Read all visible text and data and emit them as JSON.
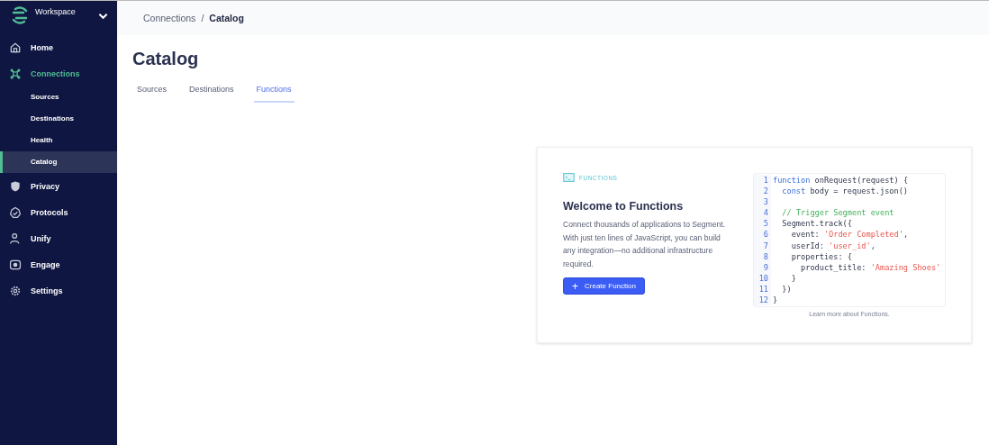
{
  "sidebar": {
    "workspace": "Workspace",
    "items": [
      {
        "label": "Home",
        "kind": "main",
        "selected": false
      },
      {
        "label": "Connections",
        "kind": "main",
        "selected": true
      },
      {
        "label": "Sources",
        "kind": "sub",
        "selected": false
      },
      {
        "label": "Destinations",
        "kind": "sub",
        "selected": false
      },
      {
        "label": "Health",
        "kind": "sub",
        "selected": false
      },
      {
        "label": "Catalog",
        "kind": "sub",
        "selected": true
      },
      {
        "label": "Privacy",
        "kind": "main",
        "selected": false
      },
      {
        "label": "Protocols",
        "kind": "main",
        "selected": false
      },
      {
        "label": "Unify",
        "kind": "main",
        "selected": false
      },
      {
        "label": "Engage",
        "kind": "main",
        "selected": false
      },
      {
        "label": "Settings",
        "kind": "main",
        "selected": false
      }
    ]
  },
  "breadcrumb": {
    "parent": "Connections",
    "separator": "/",
    "current": "Catalog"
  },
  "page_title": "Catalog",
  "tabs": [
    {
      "label": "Sources",
      "selected": false
    },
    {
      "label": "Destinations",
      "selected": false
    },
    {
      "label": "Functions",
      "selected": true
    }
  ],
  "card": {
    "eyebrow": "FUNCTIONS",
    "heading": "Welcome to Functions",
    "body": "Connect thousands of applications to Segment. With just ten lines of JavaScript, you can build any integration—no additional infrastructure required.",
    "button": {
      "icon": "+",
      "label": "Create Function"
    },
    "code": [
      {
        "number": "1",
        "tokens": [
          {
            "kind": "keyword",
            "text": "function"
          },
          {
            "kind": "plain",
            "text": " onRequest(request) {"
          }
        ]
      },
      {
        "number": "2",
        "tokens": [
          {
            "kind": "keyword",
            "text": "  const"
          },
          {
            "kind": "plain",
            "text": " body = request.json()"
          }
        ]
      },
      {
        "number": "3"
      },
      {
        "number": "4",
        "tokens": [
          {
            "kind": "comment",
            "text": "  // Trigger Segment event"
          }
        ]
      },
      {
        "number": "5",
        "tokens": [
          {
            "kind": "plain",
            "text": "  Segment.track({"
          }
        ]
      },
      {
        "number": "6",
        "tokens": [
          {
            "kind": "plain",
            "text": "    event: "
          },
          {
            "kind": "string",
            "text": "'Order Completed'"
          },
          {
            "kind": "plain",
            "text": ","
          }
        ]
      },
      {
        "number": "7",
        "tokens": [
          {
            "kind": "plain",
            "text": "    userId: "
          },
          {
            "kind": "string",
            "text": "'user_id'"
          },
          {
            "kind": "plain",
            "text": ","
          }
        ]
      },
      {
        "number": "8",
        "tokens": [
          {
            "kind": "plain",
            "text": "    properties: {"
          }
        ]
      },
      {
        "number": "9",
        "tokens": [
          {
            "kind": "plain",
            "text": "      product_title: "
          },
          {
            "kind": "string",
            "text": "'Amazing Shoes'"
          }
        ]
      },
      {
        "number": "10",
        "tokens": [
          {
            "kind": "plain",
            "text": "    }"
          }
        ]
      },
      {
        "number": "11",
        "tokens": [
          {
            "kind": "plain",
            "text": "  })"
          }
        ]
      },
      {
        "number": "12",
        "tokens": [
          {
            "kind": "plain",
            "text": "}"
          }
        ]
      }
    ],
    "link": "Learn more about Functions."
  }
}
